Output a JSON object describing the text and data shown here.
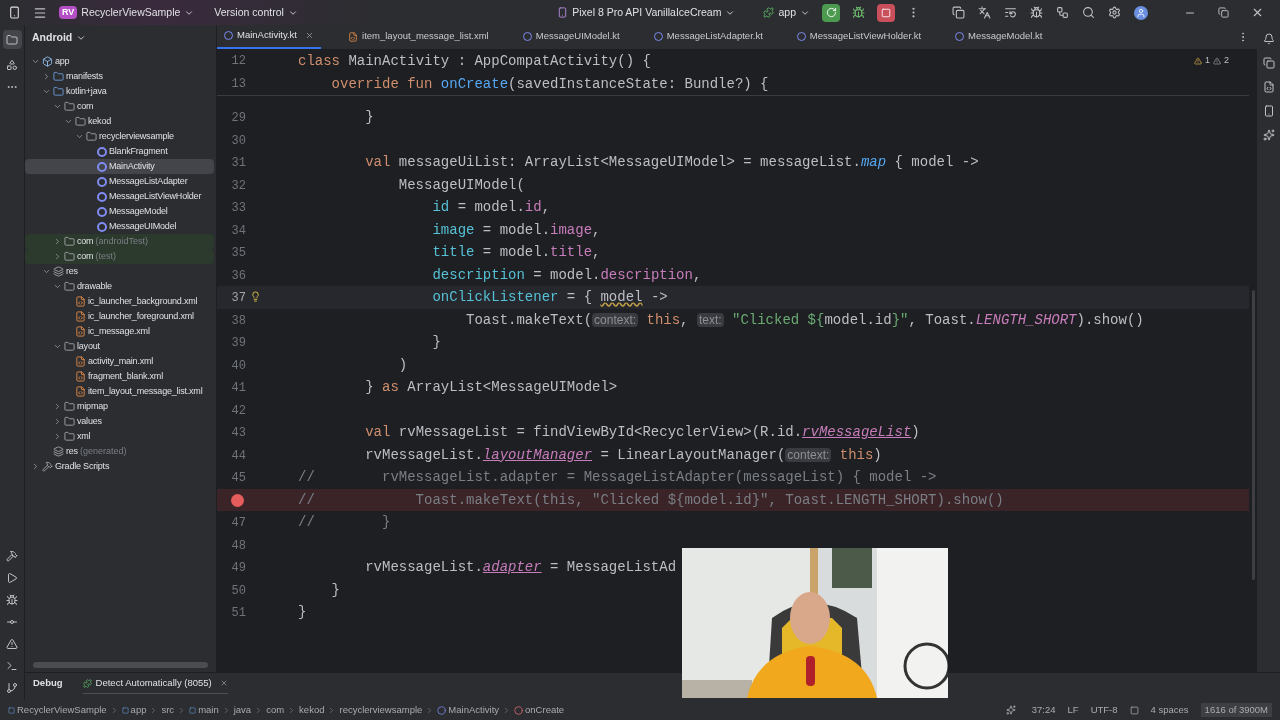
{
  "title_bar": {
    "project_badge": "RV",
    "project": "RecyclerViewSample",
    "vcs": "Version control",
    "device": "Pixel 8 Pro API VanillaIceCream",
    "run_config": "app"
  },
  "project_panel": {
    "view": "Android",
    "tree": [
      {
        "label": "app",
        "kind": "module",
        "expanded": true,
        "selected": false,
        "children": [
          {
            "label": "manifests",
            "kind": "folder",
            "expanded": false,
            "selected": false
          },
          {
            "label": "kotlin+java",
            "kind": "folder",
            "expanded": true,
            "selected": false,
            "children": [
              {
                "label": "com",
                "kind": "package",
                "expanded": true,
                "selected": false,
                "children": [
                  {
                    "label": "kekod",
                    "kind": "package",
                    "expanded": true,
                    "selected": false,
                    "children": [
                      {
                        "label": "recyclerviewsample",
                        "kind": "package",
                        "expanded": true,
                        "selected": false,
                        "children": [
                          {
                            "label": "BlankFragment",
                            "kind": "class",
                            "selected": false
                          },
                          {
                            "label": "MainActivity",
                            "kind": "class",
                            "selected": true
                          },
                          {
                            "label": "MessageListAdapter",
                            "kind": "class",
                            "selected": false
                          },
                          {
                            "label": "MessageListViewHolder",
                            "kind": "class",
                            "selected": false
                          },
                          {
                            "label": "MessageModel",
                            "kind": "class",
                            "selected": false
                          },
                          {
                            "label": "MessageUIModel",
                            "kind": "class",
                            "selected": false
                          }
                        ]
                      }
                    ]
                  }
                ]
              },
              {
                "label": "com",
                "note": "(androidTest)",
                "kind": "test-package",
                "expanded": false,
                "selected": false
              },
              {
                "label": "com",
                "note": "(test)",
                "kind": "test-package",
                "expanded": false,
                "selected": false
              }
            ]
          },
          {
            "label": "res",
            "kind": "res",
            "expanded": true,
            "selected": false,
            "children": [
              {
                "label": "drawable",
                "kind": "package",
                "expanded": true,
                "selected": false,
                "children": [
                  {
                    "label": "ic_launcher_background.xml",
                    "kind": "xml",
                    "selected": false
                  },
                  {
                    "label": "ic_launcher_foreground.xml",
                    "kind": "xml",
                    "selected": false
                  },
                  {
                    "label": "ic_message.xml",
                    "kind": "xml",
                    "selected": false
                  }
                ]
              },
              {
                "label": "layout",
                "kind": "package",
                "expanded": true,
                "selected": false,
                "children": [
                  {
                    "label": "activity_main.xml",
                    "kind": "xml",
                    "selected": false
                  },
                  {
                    "label": "fragment_blank.xml",
                    "kind": "xml",
                    "selected": false
                  },
                  {
                    "label": "item_layout_message_list.xml",
                    "kind": "xml",
                    "selected": false
                  }
                ]
              },
              {
                "label": "mipmap",
                "kind": "package",
                "expanded": false,
                "selected": false
              },
              {
                "label": "values",
                "kind": "package",
                "expanded": false,
                "selected": false
              },
              {
                "label": "xml",
                "kind": "package",
                "expanded": false,
                "selected": false
              }
            ]
          },
          {
            "label": "res",
            "note": "(generated)",
            "kind": "res",
            "selected": false
          }
        ]
      },
      {
        "label": "Gradle Scripts",
        "kind": "gradle",
        "expanded": false,
        "selected": false
      }
    ]
  },
  "tabs": [
    {
      "label": "MainActivity.kt",
      "kind": "kotlin",
      "selected": true
    },
    {
      "label": "item_layout_message_list.xml",
      "kind": "xml",
      "selected": false
    },
    {
      "label": "MessageUIModel.kt",
      "kind": "kotlin",
      "selected": false
    },
    {
      "label": "MessageListAdapter.kt",
      "kind": "kotlin",
      "selected": false
    },
    {
      "label": "MessageListViewHolder.kt",
      "kind": "kotlin",
      "selected": false
    },
    {
      "label": "MessageModel.kt",
      "kind": "kotlin",
      "selected": false
    }
  ],
  "inspections": {
    "warnings": "1",
    "weak_warnings": "2"
  },
  "sticky_lines": [
    {
      "num": "12",
      "tokens": [
        {
          "text": "class",
          "kind": "keyword"
        },
        {
          "text": " MainActivity : AppCompatActivity() {",
          "kind": "plain"
        }
      ]
    },
    {
      "num": "13",
      "tokens": [
        {
          "text": "    override fun",
          "kind": "keyword"
        },
        {
          "text": " onCreate",
          "kind": "function"
        },
        {
          "text": "(savedInstanceState: Bundle?) {",
          "kind": "plain"
        }
      ]
    }
  ],
  "code_lines": [
    {
      "num": "29",
      "kind": "plain",
      "tokens": [
        {
          "text": "        }",
          "kind": "plain"
        }
      ]
    },
    {
      "num": "30",
      "kind": "plain"
    },
    {
      "num": "31",
      "kind": "plain",
      "tokens": [
        {
          "text": "        val",
          "kind": "keyword"
        },
        {
          "text": " messageUiList: ArrayList<MessageUIModel> = messageList.",
          "kind": "plain"
        },
        {
          "text": "map",
          "kind": "call-italic"
        },
        {
          "text": " { model ->",
          "kind": "plain"
        }
      ]
    },
    {
      "num": "32",
      "kind": "plain",
      "tokens": [
        {
          "text": "            MessageUIModel(",
          "kind": "plain"
        }
      ]
    },
    {
      "num": "33",
      "kind": "plain",
      "tokens": [
        {
          "text": "                id",
          "kind": "argument"
        },
        {
          "text": " = model.",
          "kind": "plain"
        },
        {
          "text": "id",
          "kind": "property"
        },
        {
          "text": ",",
          "kind": "plain"
        }
      ]
    },
    {
      "num": "34",
      "kind": "plain",
      "tokens": [
        {
          "text": "                image",
          "kind": "argument"
        },
        {
          "text": " = model.",
          "kind": "plain"
        },
        {
          "text": "image",
          "kind": "property"
        },
        {
          "text": ",",
          "kind": "plain"
        }
      ]
    },
    {
      "num": "35",
      "kind": "plain",
      "tokens": [
        {
          "text": "                title",
          "kind": "argument"
        },
        {
          "text": " = model.",
          "kind": "plain"
        },
        {
          "text": "title",
          "kind": "property"
        },
        {
          "text": ",",
          "kind": "plain"
        }
      ]
    },
    {
      "num": "36",
      "kind": "plain",
      "tokens": [
        {
          "text": "                description",
          "kind": "argument"
        },
        {
          "text": " = model.",
          "kind": "plain"
        },
        {
          "text": "description",
          "kind": "property"
        },
        {
          "text": ",",
          "kind": "plain"
        }
      ]
    },
    {
      "num": "37",
      "kind": "current",
      "tokens": [
        {
          "text": "                onClickListener",
          "kind": "argument"
        },
        {
          "text": " = { ",
          "kind": "plain"
        },
        {
          "text": "model",
          "kind": "warning"
        },
        {
          "text": " ->",
          "kind": "plain"
        }
      ]
    },
    {
      "num": "38",
      "kind": "plain",
      "tokens": [
        {
          "text": "                    Toast.makeText(",
          "kind": "plain"
        },
        {
          "text": "context:",
          "kind": "hint"
        },
        {
          "text": " this",
          "kind": "keyword"
        },
        {
          "text": ", ",
          "kind": "plain"
        },
        {
          "text": "text:",
          "kind": "hint"
        },
        {
          "text": " \"Clicked ${",
          "kind": "string"
        },
        {
          "text": "model.id",
          "kind": "plain"
        },
        {
          "text": "}\"",
          "kind": "string"
        },
        {
          "text": ", Toast.",
          "kind": "plain"
        },
        {
          "text": "LENGTH_SHORT",
          "kind": "constant"
        },
        {
          "text": ").show()",
          "kind": "plain"
        }
      ]
    },
    {
      "num": "39",
      "kind": "plain",
      "tokens": [
        {
          "text": "                }",
          "kind": "plain"
        }
      ]
    },
    {
      "num": "40",
      "kind": "plain",
      "tokens": [
        {
          "text": "            )",
          "kind": "plain"
        }
      ]
    },
    {
      "num": "41",
      "kind": "plain",
      "tokens": [
        {
          "text": "        } ",
          "kind": "plain"
        },
        {
          "text": "as",
          "kind": "keyword"
        },
        {
          "text": " ArrayList<MessageUIModel>",
          "kind": "plain"
        }
      ]
    },
    {
      "num": "42",
      "kind": "plain"
    },
    {
      "num": "43",
      "kind": "plain",
      "tokens": [
        {
          "text": "        val",
          "kind": "keyword"
        },
        {
          "text": " rvMessageList = findViewById<RecyclerView>(R.id.",
          "kind": "plain"
        },
        {
          "text": "rvMessageList",
          "kind": "property-italic"
        },
        {
          "text": ")",
          "kind": "plain"
        }
      ]
    },
    {
      "num": "44",
      "kind": "plain",
      "tokens": [
        {
          "text": "        rvMessageList.",
          "kind": "plain"
        },
        {
          "text": "layoutManager",
          "kind": "property-italic"
        },
        {
          "text": " = LinearLayoutManager(",
          "kind": "plain"
        },
        {
          "text": "context:",
          "kind": "hint"
        },
        {
          "text": " this",
          "kind": "keyword"
        },
        {
          "text": ")",
          "kind": "plain"
        }
      ]
    },
    {
      "num": "45",
      "kind": "plain",
      "tokens": [
        {
          "text": "//        rvMessageList.adapter = MessageListAdapter(messageList) { model ->",
          "kind": "comment"
        }
      ]
    },
    {
      "kind": "breakpoint",
      "tokens": [
        {
          "text": "//            Toast.makeText(this, \"Clicked ${model.id}\", Toast.LENGTH_SHORT).show()",
          "kind": "comment"
        }
      ]
    },
    {
      "num": "47",
      "kind": "plain",
      "tokens": [
        {
          "text": "//        }",
          "kind": "comment"
        }
      ]
    },
    {
      "num": "48",
      "kind": "plain"
    },
    {
      "num": "49",
      "kind": "plain",
      "tokens": [
        {
          "text": "        rvMessageList.",
          "kind": "plain"
        },
        {
          "text": "adapter",
          "kind": "property-italic"
        },
        {
          "text": " = MessageListAd",
          "kind": "plain"
        }
      ]
    },
    {
      "num": "50",
      "kind": "plain",
      "tokens": [
        {
          "text": "    }",
          "kind": "plain"
        }
      ]
    },
    {
      "num": "51",
      "kind": "plain",
      "tokens": [
        {
          "text": "}",
          "kind": "plain"
        }
      ]
    }
  ],
  "debug_bar": {
    "title": "Debug",
    "tab": "Detect Automatically (8055)"
  },
  "status_bar": {
    "breadcrumbs": [
      {
        "label": "RecyclerViewSample",
        "kind": "module"
      },
      {
        "label": "app",
        "kind": "module"
      },
      {
        "label": "src",
        "kind": "folder"
      },
      {
        "label": "main",
        "kind": "module"
      },
      {
        "label": "java",
        "kind": "folder"
      },
      {
        "label": "com",
        "kind": "folder"
      },
      {
        "label": "kekod",
        "kind": "folder"
      },
      {
        "label": "recyclerviewsample",
        "kind": "folder"
      },
      {
        "label": "MainActivity",
        "kind": "class"
      },
      {
        "label": "onCreate",
        "kind": "function"
      }
    ],
    "position": "37:24",
    "line_separator": "LF",
    "encoding": "UTF-8",
    "indent": "4 spaces",
    "memory": "1616 of 3900M"
  }
}
